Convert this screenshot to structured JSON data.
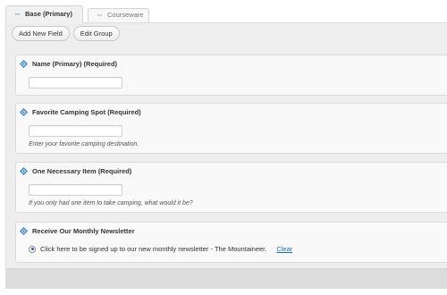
{
  "tabs": [
    {
      "label": "Base (Primary)",
      "icon": "double-arrow-icon",
      "active": true
    },
    {
      "label": "Courseware",
      "icon": "double-arrow-icon",
      "active": false
    }
  ],
  "toolbar": {
    "add_new_field_label": "Add New Field",
    "edit_group_label": "Edit Group"
  },
  "fields": [
    {
      "label": "Name (Primary) (Required)",
      "value": "",
      "description": ""
    },
    {
      "label": "Favorite Camping Spot (Required)",
      "value": "",
      "description": "Enter your favorite camping destination."
    },
    {
      "label": "One Necessary Item (Required)",
      "value": "",
      "description": "If you only had one item to take camping, what would it be?"
    },
    {
      "label": "Receive Our Monthly Newsletter",
      "radio_label": "Click here to be signed up to our new monthly newsletter - The Mountaineer.",
      "clear_label": "Clear"
    }
  ],
  "colors": {
    "accent": "#2a79c9",
    "link": "#2173b9",
    "panel": "#eeeeee"
  }
}
